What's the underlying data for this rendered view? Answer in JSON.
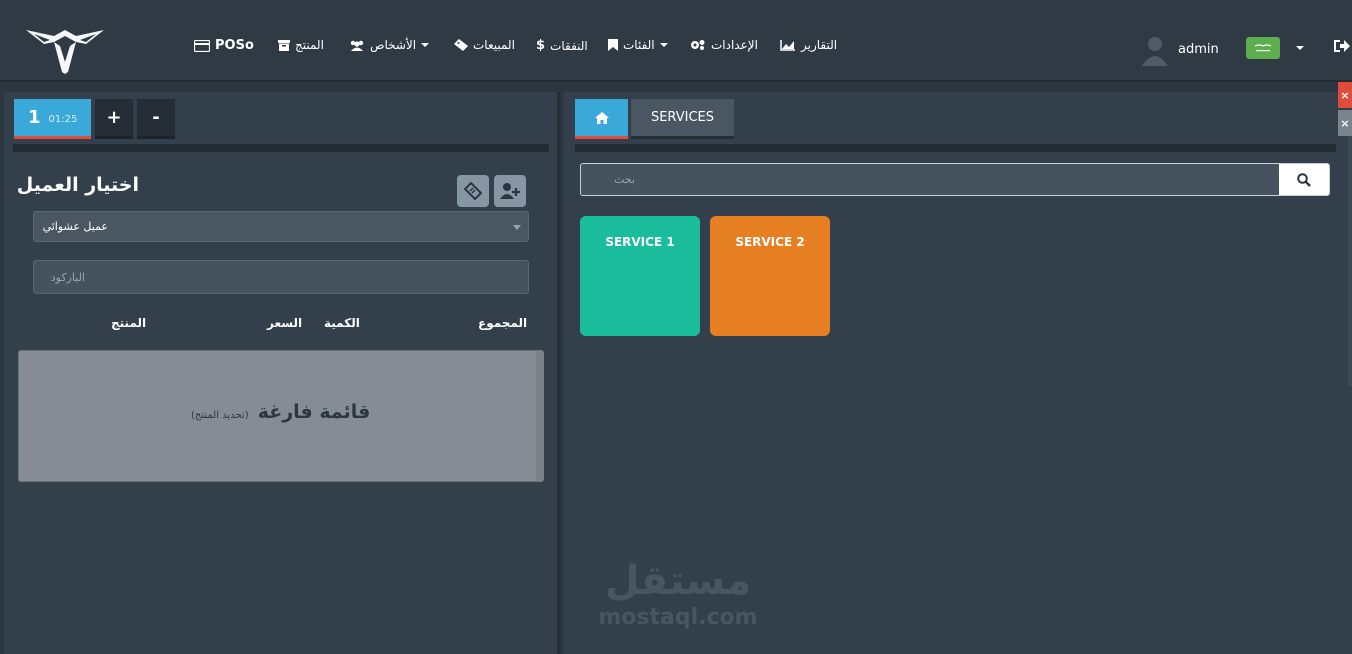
{
  "nav": {
    "brand": "POSo",
    "product": "المنتج",
    "people": "الأشخاص",
    "sales": "المبيعات",
    "expenses": "النفقات",
    "categories": "الفئات",
    "settings": "الإعدادات",
    "reports": "التقارير",
    "user": "admin"
  },
  "cart": {
    "counter": "1",
    "timer": "01:25",
    "add_label": "+",
    "remove_label": "-",
    "customer_title": "اختيار العميل",
    "customer_select": "عميل عشوائي",
    "barcode_placeholder": "الباركود",
    "columns": {
      "product": "المنتج",
      "price": "السعر",
      "quantity": "الكمية",
      "total": "المجموع"
    },
    "empty_title": "قائمة فارغة",
    "empty_hint": "(تحديد المنتج)"
  },
  "catalog": {
    "services_tab": "SERVICES",
    "search_placeholder": "بحث",
    "services": [
      {
        "name": "SERVICE 1",
        "color": "#1abc9c"
      },
      {
        "name": "SERVICE 2",
        "color": "#e67e22"
      }
    ]
  },
  "watermark": {
    "arabic": "مستقل",
    "latin": "mostaql.com"
  },
  "colors": {
    "accent_blue": "#3aa8d8",
    "accent_red": "#e04c3c"
  }
}
